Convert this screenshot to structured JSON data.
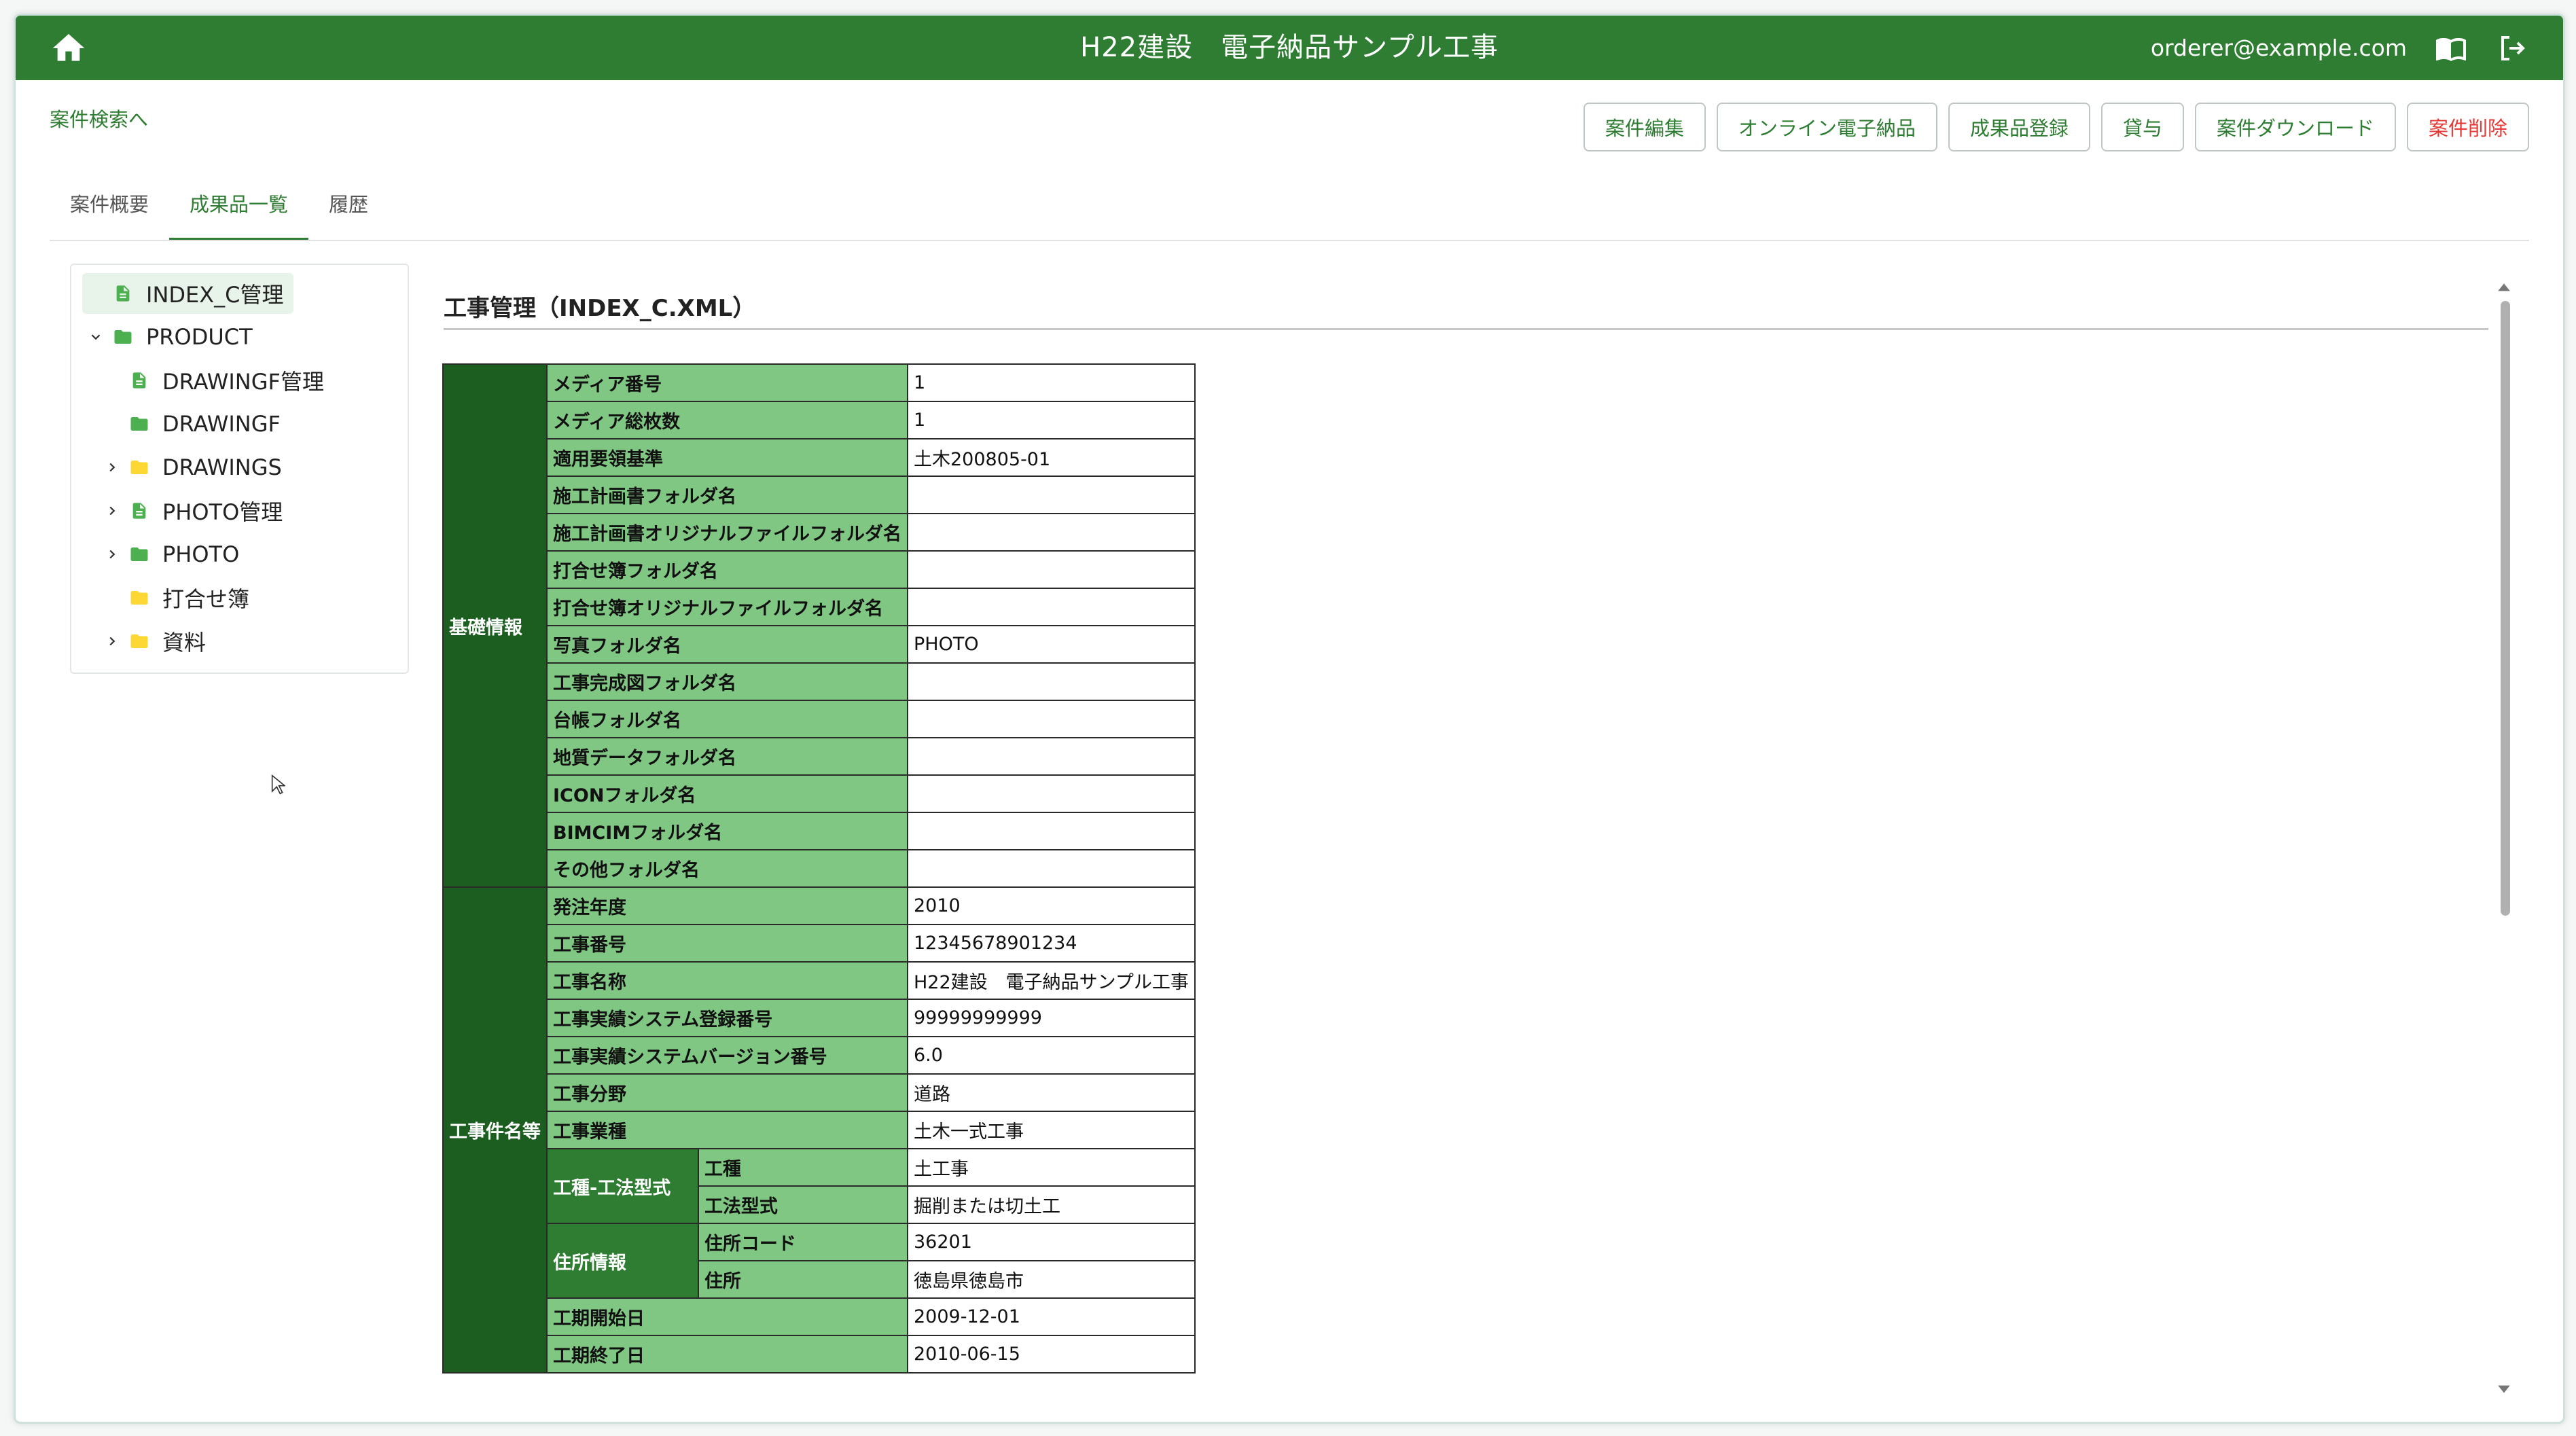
{
  "header": {
    "title": "H22建設　電子納品サンプル工事",
    "user_email": "orderer@example.com"
  },
  "back_link": "案件検索へ",
  "toolbar": {
    "edit": "案件編集",
    "online": "オンライン電子納品",
    "register": "成果品登録",
    "lend": "貸与",
    "download": "案件ダウンロード",
    "delete": "案件削除"
  },
  "tabs": [
    "案件概要",
    "成果品一覧",
    "履歴"
  ],
  "tree": [
    {
      "label": "INDEX_C管理",
      "icon": "file-icon",
      "selected": true
    },
    {
      "label": "PRODUCT",
      "icon": "folder-icon-green",
      "expanded": true
    },
    {
      "label": "DRAWINGF管理",
      "icon": "file-icon"
    },
    {
      "label": "DRAWINGF",
      "icon": "folder-icon-green"
    },
    {
      "label": "DRAWINGS",
      "icon": "folder-icon-yellow",
      "collapsed": true
    },
    {
      "label": "PHOTO管理",
      "icon": "file-icon",
      "collapsed": true
    },
    {
      "label": "PHOTO",
      "icon": "folder-icon-green",
      "collapsed": true
    },
    {
      "label": "打合せ簿",
      "icon": "folder-icon-yellow"
    },
    {
      "label": "資料",
      "icon": "folder-icon-yellow",
      "collapsed": true
    }
  ],
  "content_title": "工事管理（INDEX_C.XML）",
  "table": {
    "groups": {
      "basic": "基礎情報",
      "project": "工事件名等"
    },
    "subgroups": {
      "kousyu": "工種-工法型式",
      "address": "住所情報"
    },
    "basic_rows": [
      {
        "label": "メディア番号",
        "value": "1"
      },
      {
        "label": "メディア総枚数",
        "value": "1"
      },
      {
        "label": "適用要領基準",
        "value": "土木200805-01"
      },
      {
        "label": "施工計画書フォルダ名",
        "value": ""
      },
      {
        "label": "施工計画書オリジナルファイルフォルダ名",
        "value": ""
      },
      {
        "label": "打合せ簿フォルダ名",
        "value": ""
      },
      {
        "label": "打合せ簿オリジナルファイルフォルダ名",
        "value": ""
      },
      {
        "label": "写真フォルダ名",
        "value": "PHOTO"
      },
      {
        "label": "工事完成図フォルダ名",
        "value": ""
      },
      {
        "label": "台帳フォルダ名",
        "value": ""
      },
      {
        "label": "地質データフォルダ名",
        "value": ""
      },
      {
        "label": "ICONフォルダ名",
        "value": ""
      },
      {
        "label": "BIMCIMフォルダ名",
        "value": ""
      },
      {
        "label": "その他フォルダ名",
        "value": ""
      }
    ],
    "project_rows": [
      {
        "label": "発注年度",
        "value": "2010"
      },
      {
        "label": "工事番号",
        "value": "12345678901234"
      },
      {
        "label": "工事名称",
        "value": "H22建設　電子納品サンプル工事"
      },
      {
        "label": "工事実績システム登録番号",
        "value": "99999999999"
      },
      {
        "label": "工事実績システムバージョン番号",
        "value": "6.0"
      },
      {
        "label": "工事分野",
        "value": "道路"
      },
      {
        "label": "工事業種",
        "value": "土木一式工事"
      }
    ],
    "kousyu_rows": [
      {
        "label": "工種",
        "value": "土工事"
      },
      {
        "label": "工法型式",
        "value": "掘削または切土工"
      }
    ],
    "address_rows": [
      {
        "label": "住所コード",
        "value": "36201"
      },
      {
        "label": "住所",
        "value": "徳島県徳島市"
      }
    ],
    "period_rows": [
      {
        "label": "工期開始日",
        "value": "2009-12-01"
      },
      {
        "label": "工期終了日",
        "value": "2010-06-15"
      }
    ]
  },
  "colors": {
    "appbar": "#2e7d32",
    "group_cell": "#1b5e20",
    "label_cell": "#81c784",
    "danger": "#e53935"
  }
}
